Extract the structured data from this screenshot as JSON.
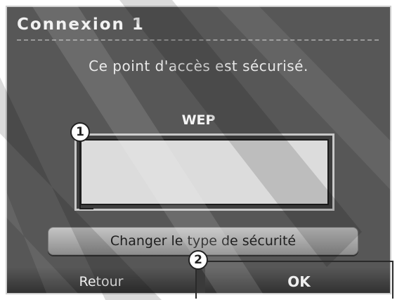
{
  "window": {
    "title": "Connexion 1"
  },
  "content": {
    "message": "Ce point d'accès est sécurisé.",
    "security_type": "WEP",
    "change_security_label": "Changer le type de sécurité"
  },
  "footer": {
    "back_label": "Retour",
    "ok_label": "OK"
  },
  "callouts": {
    "one": "1",
    "two": "2"
  },
  "colors": {
    "panel": "#575757",
    "button": "#b3b3b3",
    "field": "#dcdcdc"
  }
}
